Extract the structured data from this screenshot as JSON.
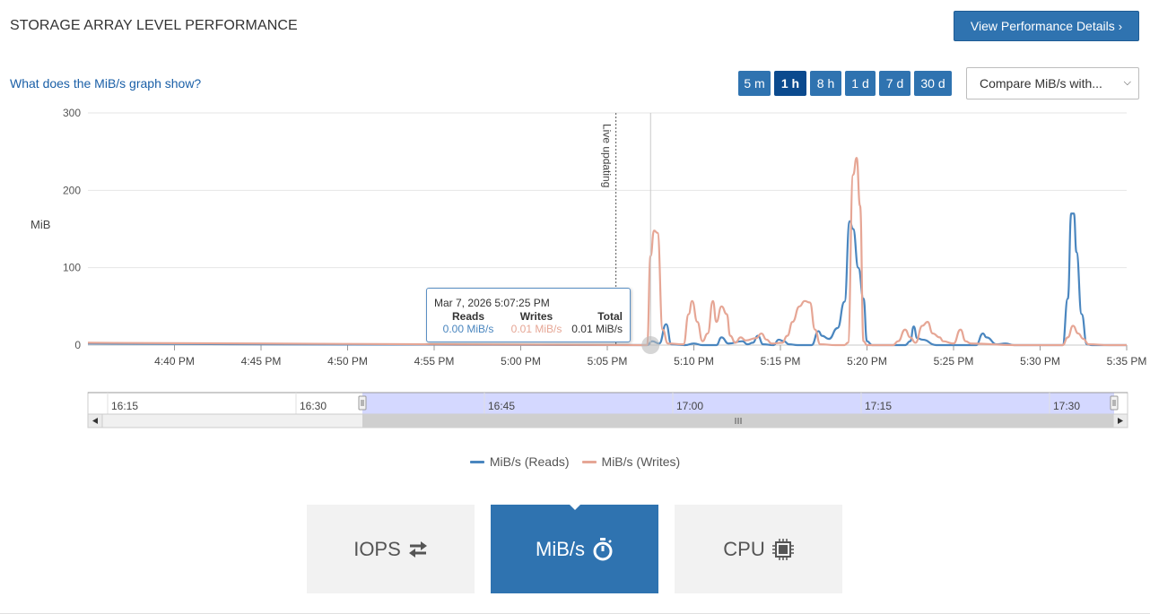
{
  "header": {
    "title": "STORAGE ARRAY LEVEL PERFORMANCE",
    "details_button": "View Performance Details"
  },
  "help_link": "What does the MiB/s graph show?",
  "time_ranges": [
    {
      "label": "5 m",
      "active": false
    },
    {
      "label": "1 h",
      "active": true
    },
    {
      "label": "8 h",
      "active": false
    },
    {
      "label": "1 d",
      "active": false
    },
    {
      "label": "7 d",
      "active": false
    },
    {
      "label": "30 d",
      "active": false
    }
  ],
  "compare_select": {
    "value": "Compare MiB/s with..."
  },
  "chart_data": {
    "type": "line",
    "ylabel": "MiB",
    "ylim": [
      0,
      300
    ],
    "yticks": [
      0,
      100,
      200,
      300
    ],
    "xlim_minutes": [
      0,
      60
    ],
    "xticks": [
      {
        "t": 5,
        "label": "4:40 PM"
      },
      {
        "t": 10,
        "label": "4:45 PM"
      },
      {
        "t": 15,
        "label": "4:50 PM"
      },
      {
        "t": 20,
        "label": "4:55 PM"
      },
      {
        "t": 25,
        "label": "5:00 PM"
      },
      {
        "t": 30,
        "label": "5:05 PM"
      },
      {
        "t": 35,
        "label": "5:10 PM"
      },
      {
        "t": 40,
        "label": "5:15 PM"
      },
      {
        "t": 45,
        "label": "5:20 PM"
      },
      {
        "t": 50,
        "label": "5:25 PM"
      },
      {
        "t": 55,
        "label": "5:30 PM"
      },
      {
        "t": 60,
        "label": "5:35 PM"
      }
    ],
    "live_marker": {
      "t": 30.5,
      "label": "Live updating"
    },
    "crosshair_t": 32.5,
    "grid": true,
    "legend_position": "bottom-center",
    "series": [
      {
        "name": "MiB/s (Reads)",
        "color": "#4a86bf",
        "points": [
          [
            0,
            2
          ],
          [
            10,
            1
          ],
          [
            20,
            0.5
          ],
          [
            32.3,
            0
          ],
          [
            32.6,
            5
          ],
          [
            33,
            2
          ],
          [
            33.4,
            27
          ],
          [
            33.7,
            1
          ],
          [
            34.5,
            0
          ],
          [
            35,
            2
          ],
          [
            35.5,
            0
          ],
          [
            36.3,
            0
          ],
          [
            36.6,
            10
          ],
          [
            37,
            2
          ],
          [
            37.8,
            5
          ],
          [
            38.1,
            1
          ],
          [
            38.4,
            3
          ],
          [
            38.7,
            12
          ],
          [
            39,
            1
          ],
          [
            39.6,
            0
          ],
          [
            39.9,
            7
          ],
          [
            40.2,
            5
          ],
          [
            40.5,
            1
          ],
          [
            41,
            0
          ],
          [
            41.8,
            0
          ],
          [
            42.2,
            18
          ],
          [
            42.4,
            12
          ],
          [
            42.8,
            8
          ],
          [
            43.3,
            22
          ],
          [
            43.7,
            56
          ],
          [
            44,
            160
          ],
          [
            44.2,
            150
          ],
          [
            44.5,
            100
          ],
          [
            44.8,
            60
          ],
          [
            45,
            5
          ],
          [
            45.3,
            0
          ],
          [
            46,
            0
          ],
          [
            46.5,
            0
          ],
          [
            47.2,
            0
          ],
          [
            47.5,
            5
          ],
          [
            47.7,
            24
          ],
          [
            47.9,
            9
          ],
          [
            48.2,
            7
          ],
          [
            49,
            0
          ],
          [
            50.5,
            0
          ],
          [
            51.3,
            0
          ],
          [
            51.7,
            15
          ],
          [
            51.9,
            10
          ],
          [
            52.5,
            1
          ],
          [
            53,
            2
          ],
          [
            53.5,
            0
          ],
          [
            55,
            0
          ],
          [
            56.3,
            0
          ],
          [
            56.6,
            60
          ],
          [
            56.8,
            170
          ],
          [
            56.95,
            170
          ],
          [
            57.1,
            120
          ],
          [
            57.4,
            40
          ],
          [
            57.7,
            1
          ],
          [
            58,
            0
          ],
          [
            60,
            0
          ]
        ]
      },
      {
        "name": "MiB/s (Writes)",
        "color": "#e6a695",
        "points": [
          [
            0,
            3
          ],
          [
            10,
            2
          ],
          [
            20,
            1
          ],
          [
            32,
            0
          ],
          [
            32.3,
            0
          ],
          [
            32.5,
            115
          ],
          [
            32.7,
            148
          ],
          [
            32.9,
            145
          ],
          [
            33.2,
            20
          ],
          [
            33.5,
            2
          ],
          [
            34.4,
            1
          ],
          [
            34.7,
            40
          ],
          [
            34.9,
            57
          ],
          [
            35.2,
            30
          ],
          [
            35.5,
            5
          ],
          [
            35.8,
            15
          ],
          [
            36.1,
            57
          ],
          [
            36.3,
            30
          ],
          [
            36.6,
            50
          ],
          [
            36.9,
            40
          ],
          [
            37.1,
            12
          ],
          [
            37.4,
            3
          ],
          [
            37.7,
            10
          ],
          [
            38,
            6
          ],
          [
            38.6,
            9
          ],
          [
            38.9,
            15
          ],
          [
            39.2,
            7
          ],
          [
            39.5,
            2
          ],
          [
            40.1,
            3
          ],
          [
            40.4,
            12
          ],
          [
            40.7,
            30
          ],
          [
            41.1,
            50
          ],
          [
            41.4,
            57
          ],
          [
            41.7,
            55
          ],
          [
            42,
            20
          ],
          [
            42.3,
            1
          ],
          [
            43.2,
            0
          ],
          [
            43.7,
            0
          ],
          [
            43.9,
            3
          ],
          [
            44.2,
            220
          ],
          [
            44.4,
            242
          ],
          [
            44.6,
            180
          ],
          [
            44.8,
            5
          ],
          [
            45,
            0
          ],
          [
            46.5,
            0
          ],
          [
            46.8,
            5
          ],
          [
            47.2,
            20
          ],
          [
            47.5,
            10
          ],
          [
            47.8,
            3
          ],
          [
            48.2,
            25
          ],
          [
            48.5,
            30
          ],
          [
            48.8,
            15
          ],
          [
            49.2,
            10
          ],
          [
            49.4,
            5
          ],
          [
            50,
            2
          ],
          [
            50.4,
            20
          ],
          [
            50.7,
            5
          ],
          [
            51,
            2
          ],
          [
            53.5,
            0
          ],
          [
            55.7,
            0
          ],
          [
            56.3,
            0
          ],
          [
            56.6,
            10
          ],
          [
            56.9,
            25
          ],
          [
            57.2,
            15
          ],
          [
            57.5,
            8
          ],
          [
            57.8,
            1
          ],
          [
            59,
            0
          ],
          [
            60,
            0
          ]
        ]
      }
    ]
  },
  "tooltip": {
    "date": "Mar 7, 2026 5:07:25 PM",
    "headers": [
      "Reads",
      "Writes",
      "Total"
    ],
    "values": [
      "0.00 MiB/s",
      "0.01 MiB/s",
      "0.01 MiB/s"
    ],
    "colors": [
      "#4a86bf",
      "#e6a695",
      "#333333"
    ]
  },
  "navigator": {
    "labels": [
      "16:15",
      "16:30",
      "16:45",
      "17:00",
      "17:15",
      "17:30"
    ]
  },
  "legend": {
    "items": [
      {
        "label": "MiB/s (Reads)",
        "color": "#4a86bf"
      },
      {
        "label": "MiB/s (Writes)",
        "color": "#e6a695"
      }
    ]
  },
  "metric_tabs": [
    {
      "label": "IOPS",
      "icon": "swap-arrows-icon",
      "active": false
    },
    {
      "label": "MiB/s",
      "icon": "stopwatch-icon",
      "active": true
    },
    {
      "label": "CPU",
      "icon": "cpu-chip-icon",
      "active": false
    }
  ]
}
